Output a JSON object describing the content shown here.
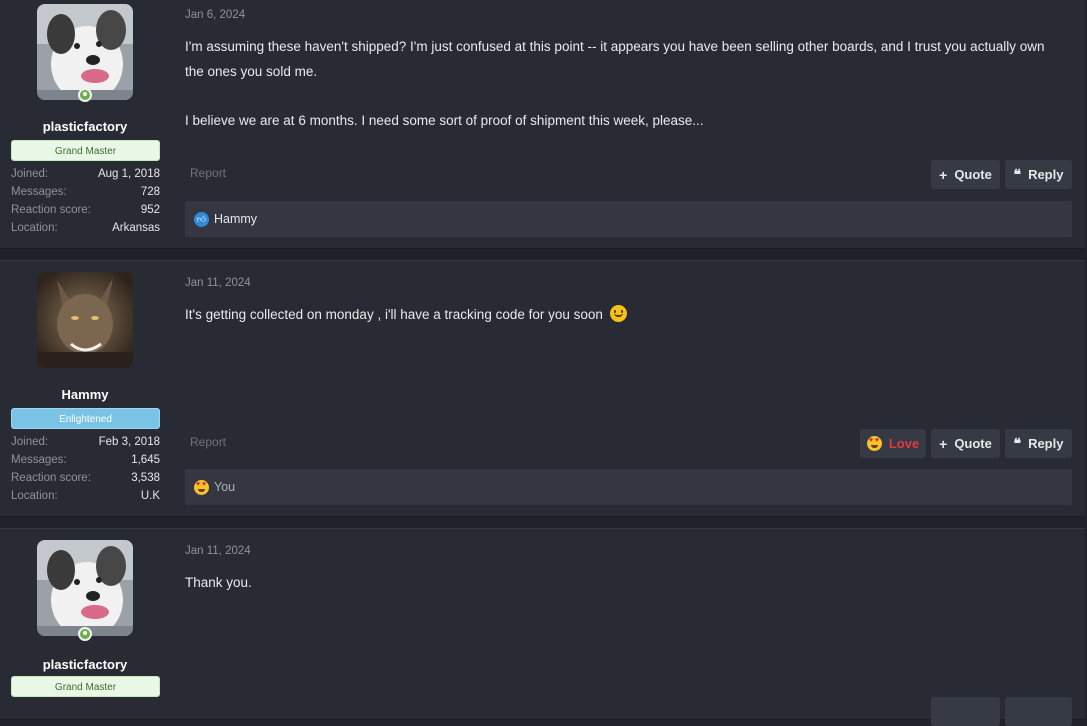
{
  "posts": [
    {
      "user": {
        "name": "plasticfactory",
        "rank": "Grand Master",
        "online": true,
        "stats": [
          {
            "label": "Joined:",
            "value": "Aug 1, 2018"
          },
          {
            "label": "Messages:",
            "value": "728"
          },
          {
            "label": "Reaction score:",
            "value": "952"
          },
          {
            "label": "Location:",
            "value": "Arkansas"
          }
        ]
      },
      "date": "Jan 6, 2024",
      "body": [
        "I'm assuming these haven't shipped? I'm just confused at this point -- it appears you have been selling other boards, and I trust you actually own the ones you sold me.",
        "I believe we are at 6 months. I need some sort of proof of shipment this week, please..."
      ],
      "report_label": "Report",
      "quote_label": "Quote",
      "reply_label": "Reply",
      "reactions": {
        "icon": "like-icon",
        "text": "Hammy"
      }
    },
    {
      "user": {
        "name": "Hammy",
        "rank": "Enlightened",
        "online": false,
        "stats": [
          {
            "label": "Joined:",
            "value": "Feb 3, 2018"
          },
          {
            "label": "Messages:",
            "value": "1,645"
          },
          {
            "label": "Reaction score:",
            "value": "3,538"
          },
          {
            "label": "Location:",
            "value": "U.K"
          }
        ]
      },
      "date": "Jan 11, 2024",
      "body": [
        "It's getting collected on monday , i'll have a tracking code for you soon"
      ],
      "report_label": "Report",
      "love_label": "Love",
      "quote_label": "Quote",
      "reply_label": "Reply",
      "reactions": {
        "icon": "heart-eyes-emoji-icon",
        "text": "You"
      }
    },
    {
      "user": {
        "name": "plasticfactory",
        "rank": "Grand Master",
        "online": true
      },
      "date": "Jan 11, 2024",
      "body": [
        "Thank you."
      ]
    }
  ],
  "colors": {
    "background": "#282b33",
    "love": "#e03b3b",
    "like": "#2f8bd8",
    "grand_master_badge": "#e9f8e6",
    "enlightened_badge": "#79c4e6"
  }
}
